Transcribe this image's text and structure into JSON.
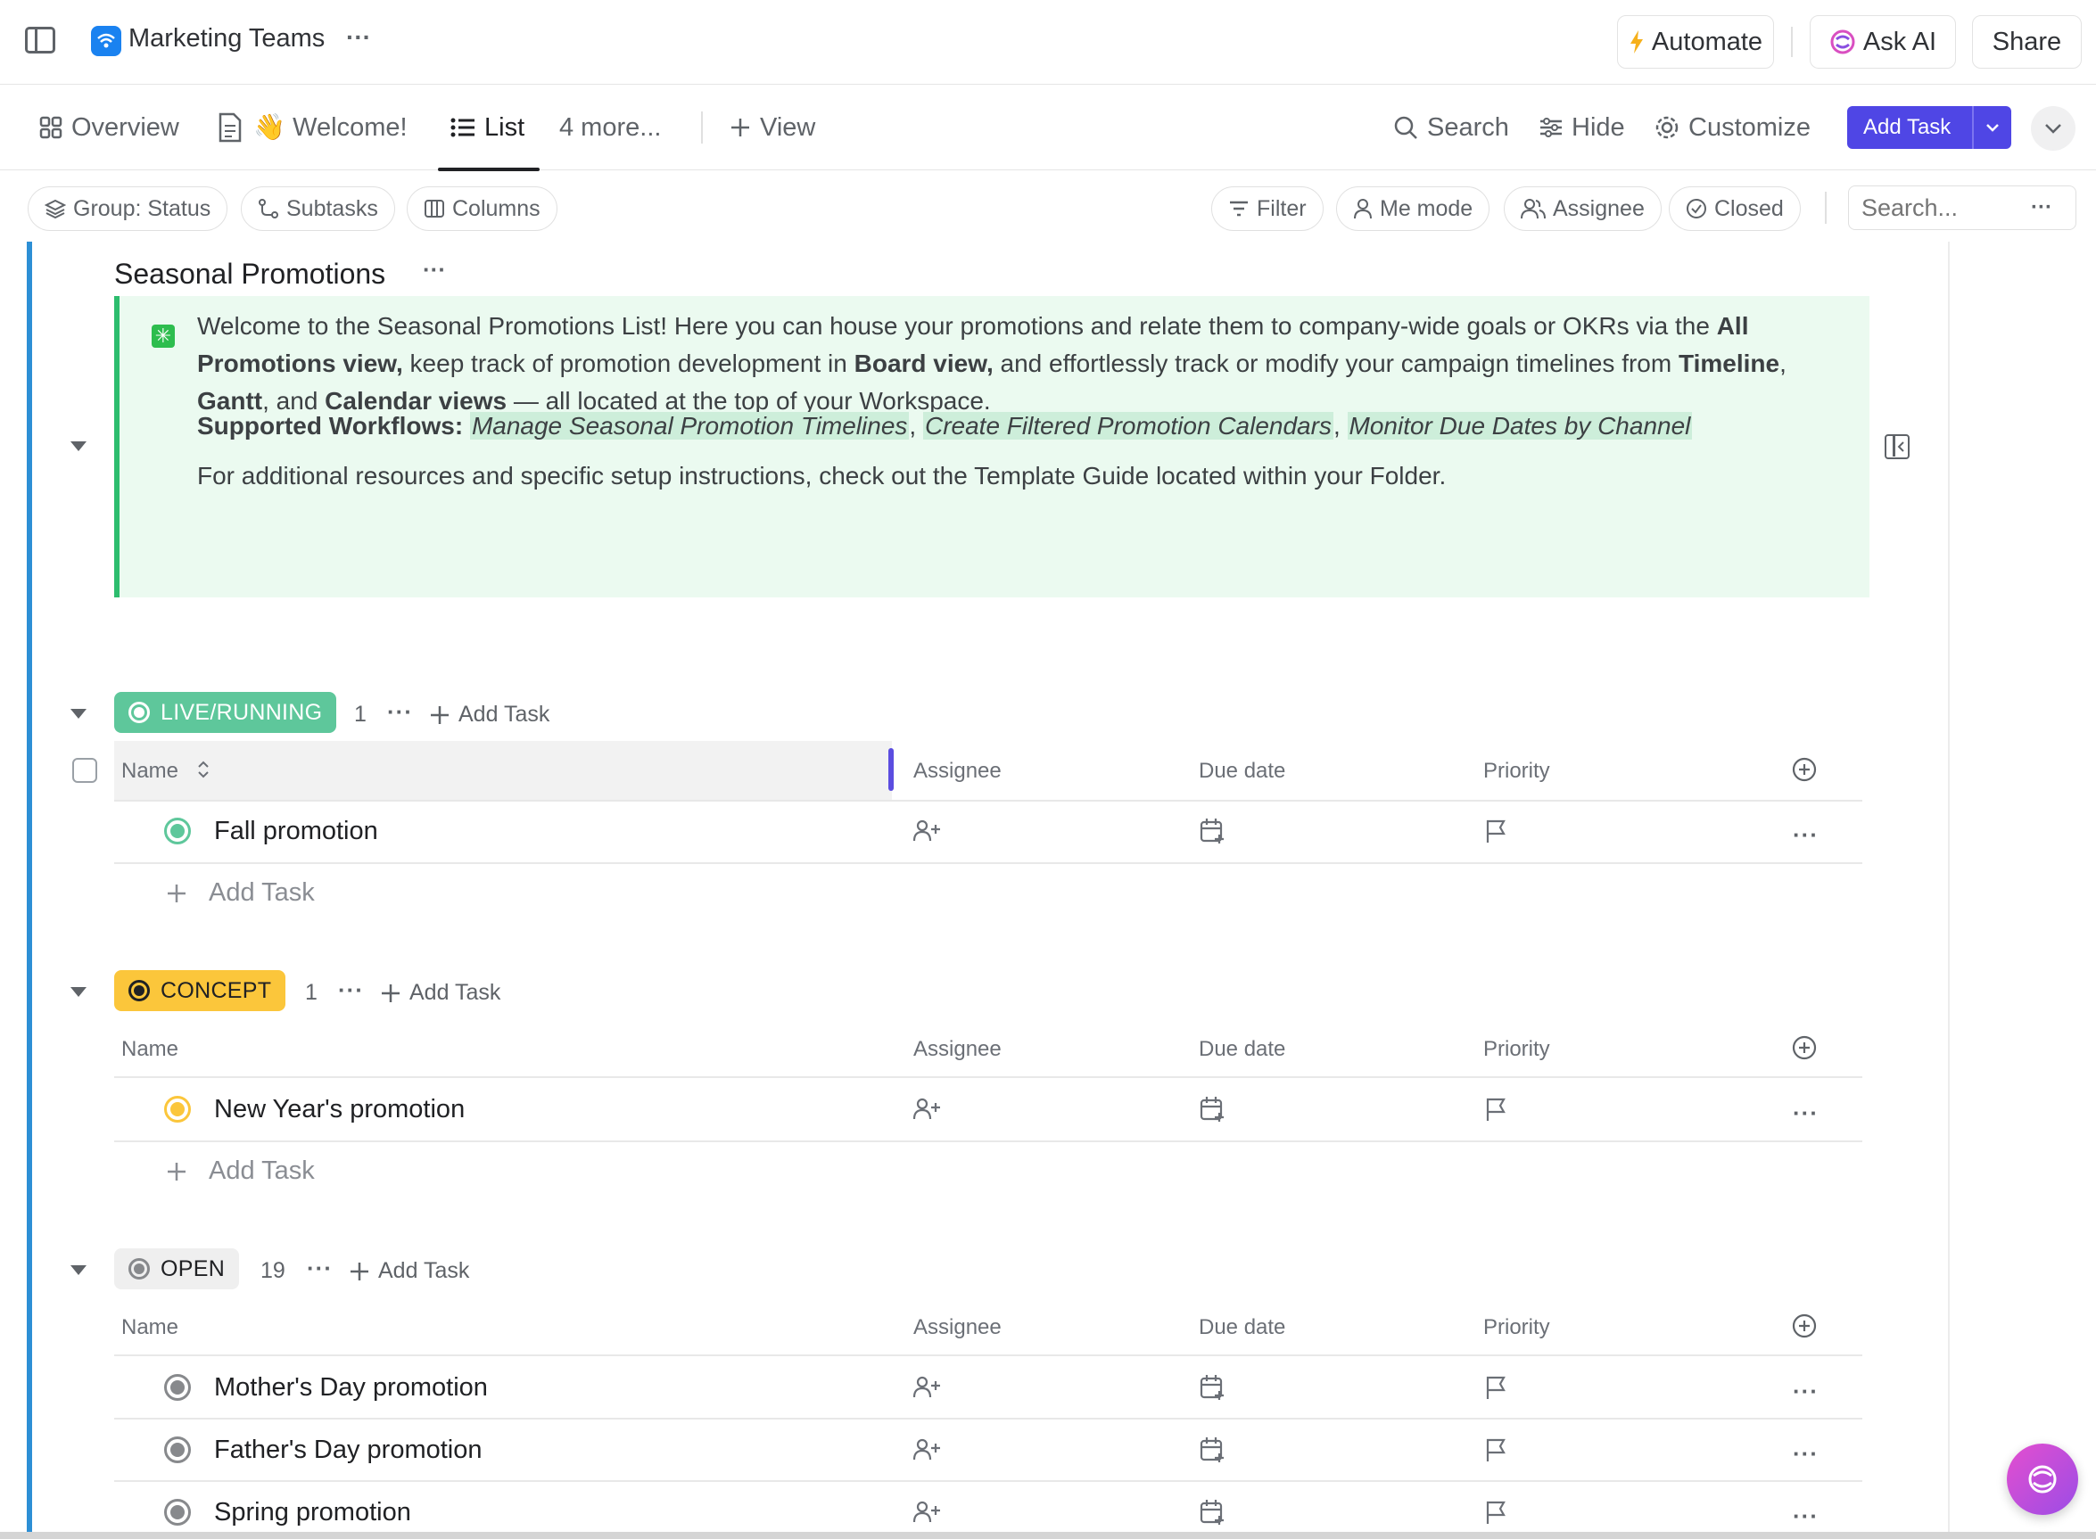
{
  "header": {
    "workspace_name": "Marketing Teams",
    "more": "···",
    "automate_label": "Automate",
    "ask_ai_label": "Ask AI",
    "share_label": "Share"
  },
  "tabs": {
    "overview": "Overview",
    "welcome": "👋 Welcome!",
    "list": "List",
    "more": "4 more...",
    "view": "View"
  },
  "tools": {
    "search": "Search",
    "hide": "Hide",
    "customize": "Customize",
    "add_task": "Add Task"
  },
  "filters": {
    "group": "Group: Status",
    "subtasks": "Subtasks",
    "columns": "Columns",
    "filter": "Filter",
    "me_mode": "Me mode",
    "assignee": "Assignee",
    "closed": "Closed",
    "search_placeholder": "Search..."
  },
  "list": {
    "title": "Seasonal Promotions",
    "description": {
      "intro_1": "Welcome to the Seasonal Promotions List! Here you can house your promotions and relate them to company-wide goals or OKRs via the ",
      "all_promotions": "All Promotions view,",
      "intro_2": " keep track of promotion development in ",
      "board_view": "Board view,",
      "intro_3": " and effortlessly track or modify your campaign timelines from ",
      "timeline": "Timeline",
      "comma1": ", ",
      "gantt": "Gantt",
      "and": ", and ",
      "calendar_views": "Calendar views",
      "intro_4": " — all located at the top of your Workspace.",
      "workflows_label": "Supported Workflows:",
      "workflow_1": "Manage Seasonal Promotion Timelines",
      "workflow_2": "Create Filtered Promotion Calendars",
      "workflow_3": "Monitor Due Dates by Channel",
      "resources": "For additional resources and specific setup instructions, check out the Template Guide located within your Folder."
    }
  },
  "columns": {
    "name": "Name",
    "assignee": "Assignee",
    "due_date": "Due date",
    "priority": "Priority"
  },
  "groups": [
    {
      "status": "LIVE/RUNNING",
      "count": "1",
      "add_task": "Add Task",
      "color": "#5ec79b",
      "tasks": [
        {
          "name": "Fall promotion"
        }
      ]
    },
    {
      "status": "CONCEPT",
      "count": "1",
      "add_task": "Add Task",
      "color": "#fbc63b",
      "tasks": [
        {
          "name": "New Year's promotion"
        }
      ]
    },
    {
      "status": "OPEN",
      "count": "19",
      "add_task": "Add Task",
      "color": "#87898c",
      "tasks": [
        {
          "name": "Mother's Day promotion"
        },
        {
          "name": "Father's Day promotion"
        },
        {
          "name": "Spring promotion"
        }
      ]
    }
  ],
  "add_task_row": "Add Task",
  "colors": {
    "primary": "#4f46e5",
    "accent_blue": "#2d8fd5",
    "callout_bg": "#ebfaf0",
    "callout_border": "#2dbd6e"
  }
}
